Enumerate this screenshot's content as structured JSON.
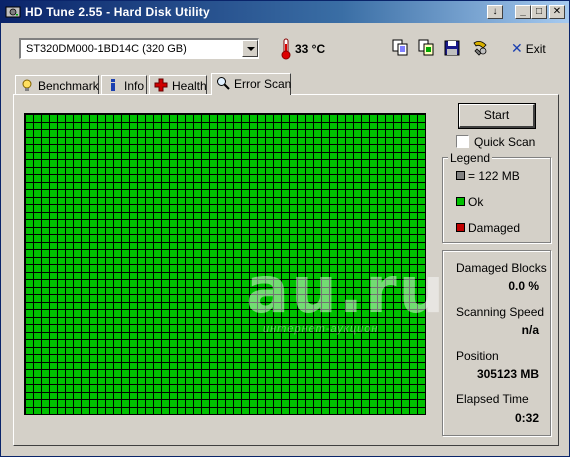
{
  "window": {
    "title": "HD Tune 2.55 - Hard Disk Utility"
  },
  "titlebar_buttons": {
    "menu": "↓",
    "minimize": "_",
    "maximize": "□",
    "close": "✕"
  },
  "toolbar": {
    "drive": "ST320DM000-1BD14C (320 GB)",
    "temperature": "33 °C",
    "exit_label": "Exit"
  },
  "tabs": [
    {
      "label": "Benchmark",
      "icon": "benchmark-icon"
    },
    {
      "label": "Info",
      "icon": "info-icon"
    },
    {
      "label": "Health",
      "icon": "health-cross-icon"
    },
    {
      "label": "Error Scan",
      "icon": "magnifier-icon",
      "active": true
    }
  ],
  "scan": {
    "start_label": "Start",
    "quick_scan_label": "Quick Scan",
    "quick_scan_checked": false,
    "grid": {
      "columns": 50,
      "rows": 40,
      "state": "Ok"
    }
  },
  "legend": {
    "title": "Legend",
    "items": [
      {
        "label": "= 122 MB",
        "color": "#808080"
      },
      {
        "label": "Ok",
        "color": "#00c000"
      },
      {
        "label": "Damaged",
        "color": "#c00000"
      }
    ]
  },
  "stats": [
    {
      "label": "Damaged Blocks",
      "value": "0.0 %"
    },
    {
      "label": "Scanning Speed",
      "value": "n/a"
    },
    {
      "label": "Position",
      "value": "305123 MB"
    },
    {
      "label": "Elapsed Time",
      "value": "0:32"
    }
  ],
  "watermark": {
    "text": "au.ru",
    "subtext": "интернет-аукцион"
  },
  "colors": {
    "ok_green": "#00c000",
    "grid_lines": "#000000",
    "face": "#d4d0c8"
  }
}
